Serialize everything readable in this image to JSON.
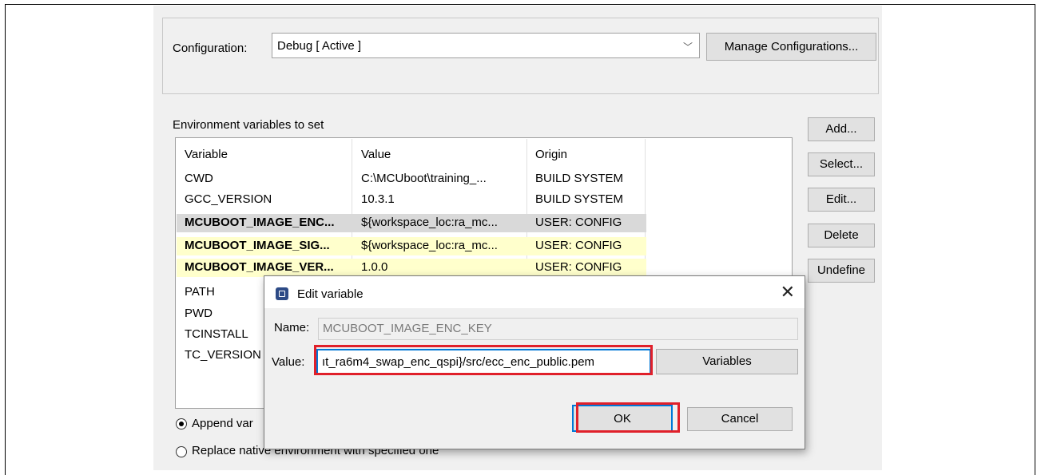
{
  "configuration": {
    "label": "Configuration:",
    "selected": "Debug  [ Active ]",
    "manage_button": "Manage Configurations..."
  },
  "environment": {
    "section_label": "Environment variables to set",
    "columns": [
      "Variable",
      "Value",
      "Origin"
    ],
    "rows": [
      {
        "variable": "CWD",
        "value": "C:\\MCUboot\\training_...",
        "origin": "BUILD SYSTEM"
      },
      {
        "variable": "GCC_VERSION",
        "value": "10.3.1",
        "origin": "BUILD SYSTEM"
      },
      {
        "variable": "MCUBOOT_IMAGE_ENC...",
        "value": "${workspace_loc:ra_mc...",
        "origin": "USER: CONFIG"
      },
      {
        "variable": "MCUBOOT_IMAGE_SIG...",
        "value": "${workspace_loc:ra_mc...",
        "origin": "USER: CONFIG"
      },
      {
        "variable": "MCUBOOT_IMAGE_VER...",
        "value": "1.0.0",
        "origin": "USER: CONFIG"
      },
      {
        "variable": "PATH",
        "value": "",
        "origin": ""
      },
      {
        "variable": "PWD",
        "value": "",
        "origin": ""
      },
      {
        "variable": "TCINSTALL",
        "value": "",
        "origin": ""
      },
      {
        "variable": "TC_VERSION",
        "value": "",
        "origin": ""
      }
    ],
    "buttons": {
      "add": "Add...",
      "select": "Select...",
      "edit": "Edit...",
      "delete": "Delete",
      "undefine": "Undefine"
    },
    "radio_append": "Append var",
    "radio_replace": "Replace native environment with specified one"
  },
  "dialog": {
    "title": "Edit variable",
    "close_glyph": "✕",
    "name_label": "Name:",
    "name_value": "MCUBOOT_IMAGE_ENC_KEY",
    "value_label": "Value:",
    "value_text": "ıt_ra6m4_swap_enc_qspi}/src/ecc_enc_public.pem",
    "variables_button": "Variables",
    "ok_button": "OK",
    "cancel_button": "Cancel"
  },
  "colors": {
    "highlight": "#e0202a",
    "user_row": "#ffffcc",
    "selected_row": "#d9d9d9",
    "focus_border": "#0078d7"
  }
}
